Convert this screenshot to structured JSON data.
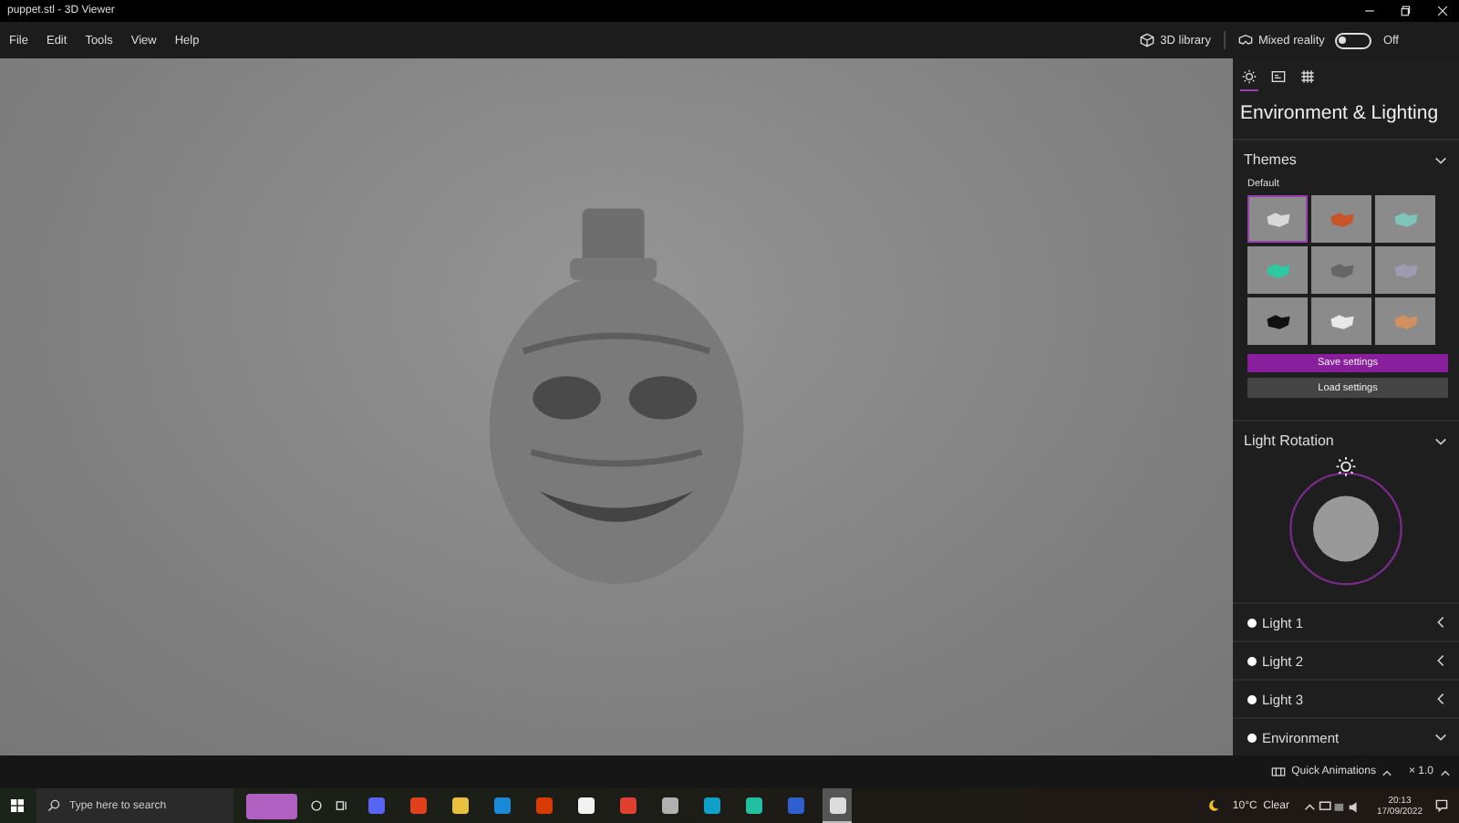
{
  "window": {
    "title": "puppet.stl - 3D Viewer"
  },
  "menu": [
    "File",
    "Edit",
    "Tools",
    "View",
    "Help"
  ],
  "toolbar": {
    "library": "3D library",
    "mixed_reality": {
      "label": "Mixed reality",
      "on": false,
      "state_text": "Off"
    }
  },
  "panel": {
    "tabs": [
      {
        "kind": "sun",
        "selected": true
      },
      {
        "kind": "stats",
        "selected": false
      },
      {
        "kind": "grid",
        "selected": false
      }
    ],
    "title": "Environment & Lighting",
    "themes": {
      "heading": "Themes",
      "expanded": true,
      "group": "Default",
      "items": [
        {
          "color": "#d8d8d8",
          "selected": true
        },
        {
          "color": "#c8552a",
          "selected": false
        },
        {
          "color": "#7fc4b8",
          "selected": false
        },
        {
          "color": "#2ec9a0",
          "selected": false
        },
        {
          "color": "#666666",
          "selected": false
        },
        {
          "color": "#a09ab0",
          "selected": false
        },
        {
          "color": "#111111",
          "selected": false
        },
        {
          "color": "#e8e8e8",
          "selected": false
        },
        {
          "color": "#d09060",
          "selected": false
        }
      ],
      "save": "Save settings",
      "load": "Load settings"
    },
    "rotation": {
      "heading": "Light Rotation",
      "expanded": true
    },
    "lights": [
      {
        "label": "Light 1",
        "expanded": false
      },
      {
        "label": "Light 2",
        "expanded": false
      },
      {
        "label": "Light 3",
        "expanded": false
      },
      {
        "label": "Environment",
        "expanded": true
      }
    ]
  },
  "animation_bar": {
    "label": "Quick Animations",
    "speed": "× 1.0"
  },
  "taskbar": {
    "search": {
      "placeholder": "Type here to search"
    },
    "apps": [
      {
        "color": "#5865f2",
        "selected": false
      },
      {
        "color": "#e0401c",
        "selected": false
      },
      {
        "color": "#e8c040",
        "selected": false
      },
      {
        "color": "#1a8ad8",
        "selected": false
      },
      {
        "color": "#d83b01",
        "selected": false
      },
      {
        "color": "#f2f2f2",
        "selected": false
      },
      {
        "color": "#e04030",
        "selected": false
      },
      {
        "color": "#b0b0b0",
        "selected": false
      },
      {
        "color": "#0fa0c8",
        "selected": false
      },
      {
        "color": "#20c0a0",
        "selected": false
      },
      {
        "color": "#3060d0",
        "selected": false
      },
      {
        "color": "#dcdcdc",
        "selected": true
      }
    ],
    "weather": "10°C  Clear",
    "time": "20:13",
    "date": "17/09/2022"
  }
}
